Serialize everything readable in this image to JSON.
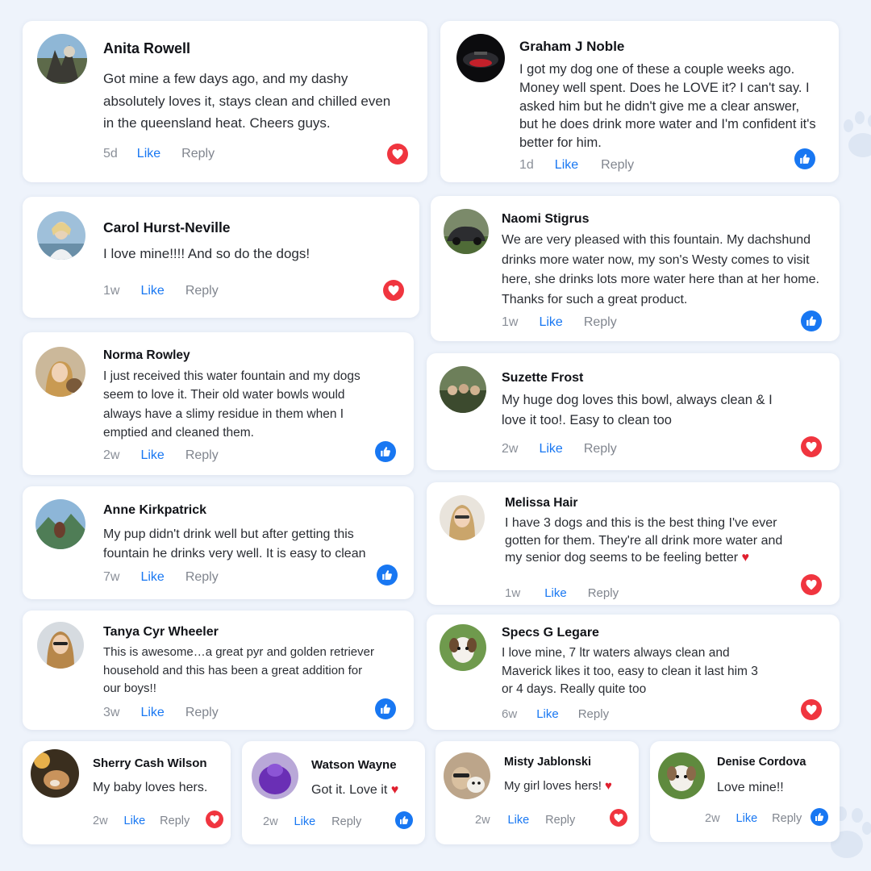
{
  "colors": {
    "like_blue": "#1877f2",
    "love_red": "#f0353f",
    "background": "#eef3fb"
  },
  "comments": [
    {
      "name": "Anita Rowell",
      "text": "Got mine a few days ago, and my dashy absolutely loves it, stays clean and chilled even in the queensland heat. Cheers guys.",
      "time": "5d",
      "like_label": "Like",
      "reply_label": "Reply",
      "reaction": "love-icon"
    },
    {
      "name": "Graham J Noble",
      "text": "I got my dog one of these a couple weeks ago. Money well spent. Does he LOVE it? I can't say. I asked him but he didn't give me a clear answer, but he does drink more water and I'm confident it's better for him.",
      "time": "1d",
      "like_label": "Like",
      "reply_label": "Reply",
      "reaction": "thumbs-up-icon"
    },
    {
      "name": "Carol Hurst-Neville",
      "text": "I love mine!!!! And so do the dogs!",
      "time": "1w",
      "like_label": "Like",
      "reply_label": "Reply",
      "reaction": "love-icon"
    },
    {
      "name": "Naomi Stigrus",
      "text": "We are very pleased with this fountain. My dachshund drinks more water now, my son's Westy comes to visit here, she drinks lots more water here than at her home. Thanks for such a great product.",
      "time": "1w",
      "like_label": "Like",
      "reply_label": "Reply",
      "reaction": "thumbs-up-icon"
    },
    {
      "name": "Norma Rowley",
      "text": "I just received this water fountain and my dogs seem to love it. Their old water bowls would always have a slimy residue in them when I emptied and cleaned them.",
      "time": "2w",
      "like_label": "Like",
      "reply_label": "Reply",
      "reaction": "thumbs-up-icon"
    },
    {
      "name": "Suzette Frost",
      "text": "My huge dog loves this bowl, always clean & I love it too!. Easy to clean too",
      "time": "2w",
      "like_label": "Like",
      "reply_label": "Reply",
      "reaction": "love-icon"
    },
    {
      "name": "Anne Kirkpatrick",
      "text": "My pup didn't drink well but after getting this fountain he drinks very well. It is easy to clean",
      "time": "7w",
      "like_label": "Like",
      "reply_label": "Reply",
      "reaction": "thumbs-up-icon"
    },
    {
      "name": "Melissa Hair",
      "text": "I have 3 dogs and this is the best thing I've ever gotten for them. They're all drink more water and my senior dog seems to be feeling better",
      "emoji": "♥",
      "time": "1w",
      "like_label": "Like",
      "reply_label": "Reply",
      "reaction": "love-icon"
    },
    {
      "name": "Tanya Cyr Wheeler",
      "text": "This is awesome…a great pyr and golden retriever household and this has been a great addition for our boys!!",
      "time": "3w",
      "like_label": "Like",
      "reply_label": "Reply",
      "reaction": "thumbs-up-icon"
    },
    {
      "name": "Specs G Legare",
      "text": "I love mine, 7 ltr waters always clean and Maverick likes it too, easy to clean it last him 3 or 4 days. Really quite too",
      "time": "6w",
      "like_label": "Like",
      "reply_label": "Reply",
      "reaction": "love-icon"
    },
    {
      "name": "Sherry Cash Wilson",
      "text": "My baby loves hers.",
      "time": "2w",
      "like_label": "Like",
      "reply_label": "Reply",
      "reaction": "love-icon"
    },
    {
      "name": "Watson Wayne",
      "text": "Got it. Love it",
      "emoji": "♥",
      "time": "2w",
      "like_label": "Like",
      "reply_label": "Reply",
      "reaction": "thumbs-up-icon"
    },
    {
      "name": "Misty Jablonski",
      "text": "My girl loves hers!",
      "emoji": "♥",
      "time": "2w",
      "like_label": "Like",
      "reply_label": "Reply",
      "reaction": "love-icon"
    },
    {
      "name": "Denise Cordova",
      "text": "Love mine!!",
      "time": "2w",
      "like_label": "Like",
      "reply_label": "Reply",
      "reaction": "thumbs-up-icon"
    }
  ]
}
